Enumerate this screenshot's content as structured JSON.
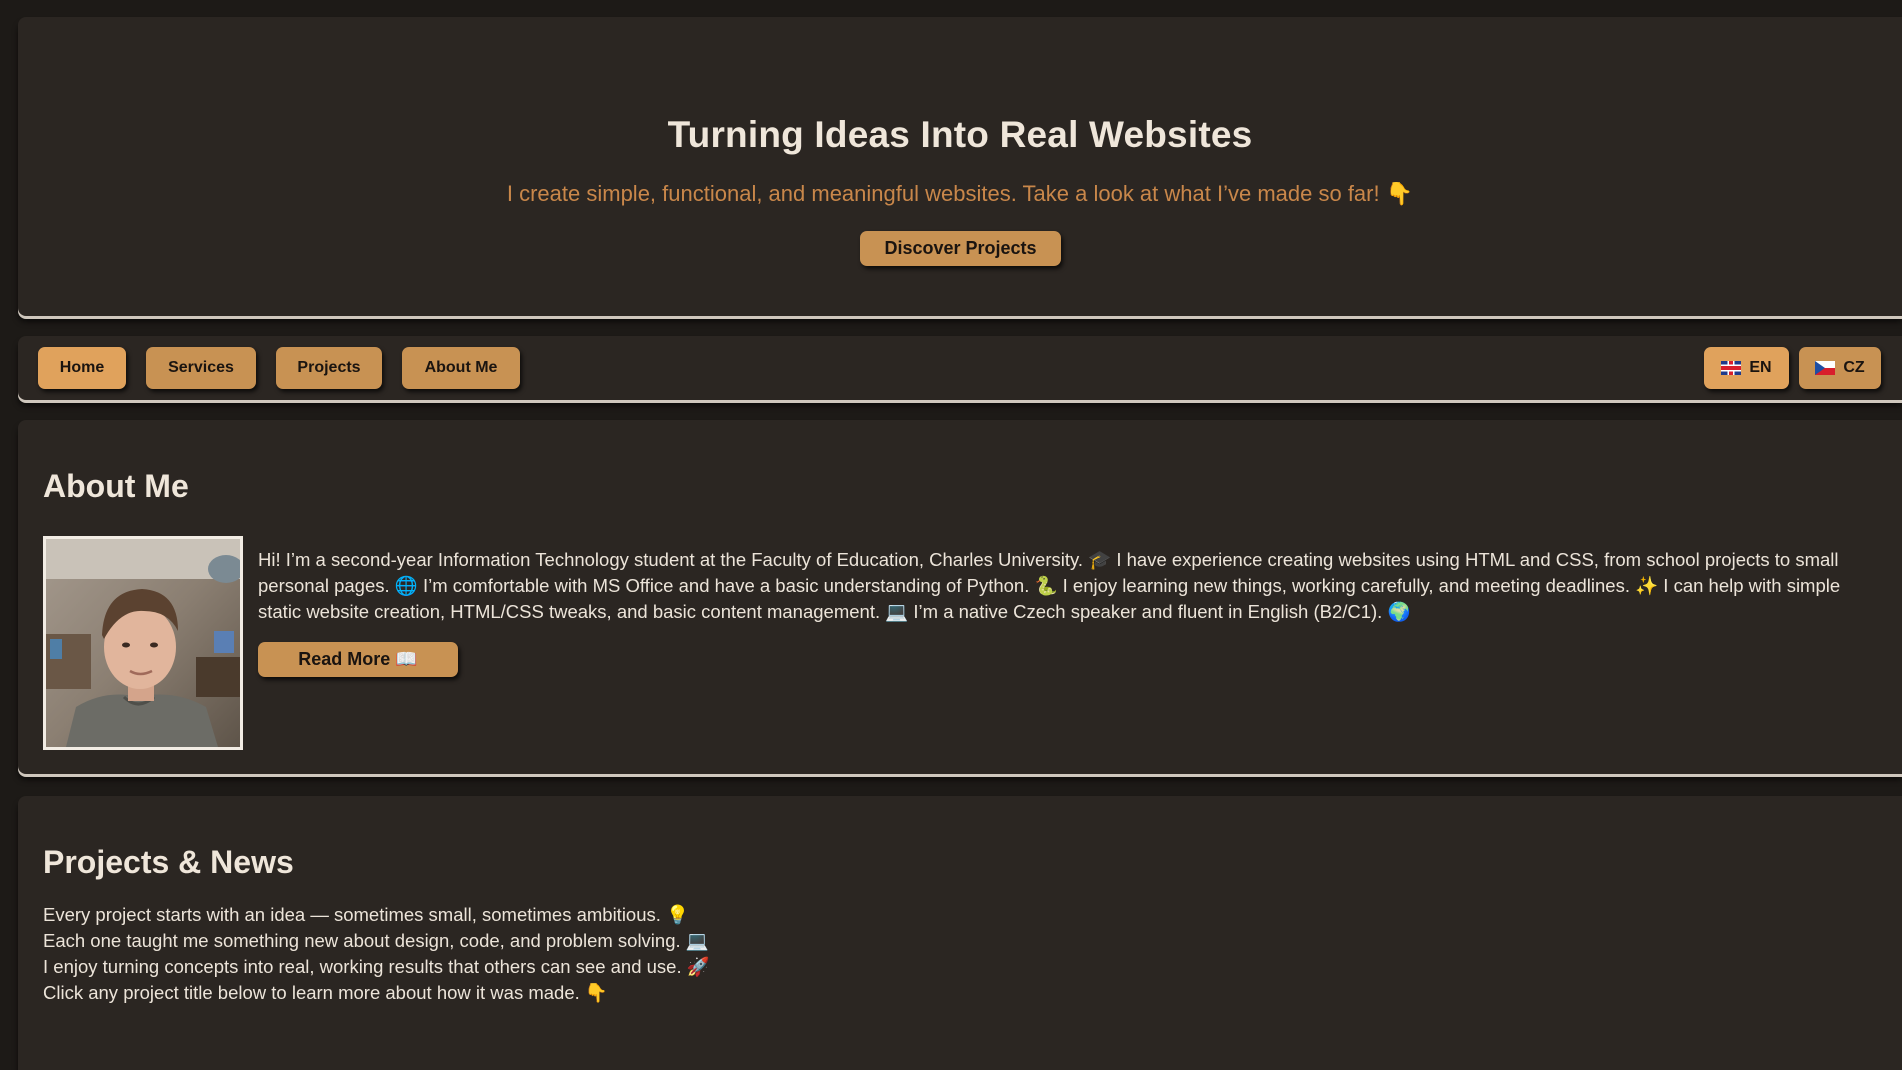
{
  "hero": {
    "title": "Turning Ideas Into Real Websites",
    "subtitle": "I create simple, functional, and meaningful websites. Take a look at what I’ve made so far! 👇",
    "cta_label": "Discover Projects"
  },
  "nav": {
    "items": [
      {
        "label": "Home"
      },
      {
        "label": "Services"
      },
      {
        "label": "Projects"
      },
      {
        "label": "About Me"
      }
    ],
    "languages": [
      {
        "code": "EN",
        "icon": "uk-flag-icon"
      },
      {
        "code": "CZ",
        "icon": "cz-flag-icon"
      }
    ],
    "active_item": "Home",
    "active_language": "EN"
  },
  "about": {
    "heading": "About Me",
    "text": "Hi! I’m a second-year Information Technology student at the Faculty of Education, Charles University. 🎓 I have experience creating websites using HTML and CSS, from school projects to small personal pages. 🌐 I’m comfortable with MS Office and have a basic understanding of Python. 🐍 I enjoy learning new things, working carefully, and meeting deadlines. ✨ I can help with simple static website creation, HTML/CSS tweaks, and basic content management. 💻 I’m a native Czech speaker and fluent in English (B2/C1). 🌍",
    "read_more_label": "Read More 📖"
  },
  "projects": {
    "heading": "Projects & News",
    "lines": [
      "Every project starts with an idea — sometimes small, sometimes ambitious. 💡",
      "Each one taught me something new about design, code, and problem solving. 💻",
      "I enjoy turning concepts into real, working results that others can see and use. 🚀",
      "Click any project title below to learn more about how it was made. 👇"
    ]
  },
  "colors": {
    "background": "#1d1a17",
    "panel": "#2b2622",
    "accent": "#c89253",
    "accent_active": "#e0a25c",
    "subtitle": "#c9874a"
  }
}
